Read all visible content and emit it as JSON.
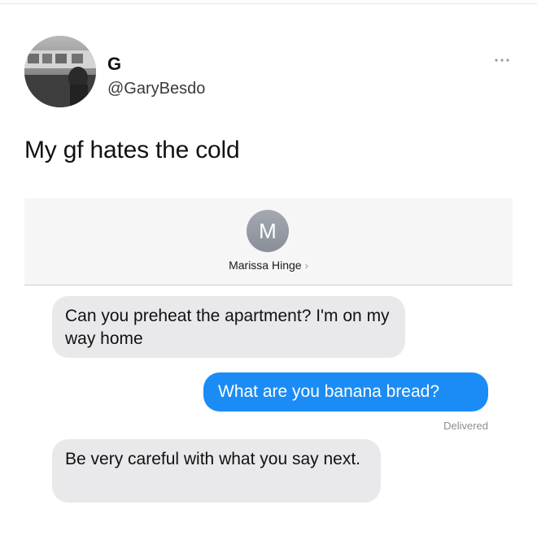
{
  "tweet": {
    "display_name": "G",
    "handle": "@GaryBesdo",
    "text": "My gf hates the cold",
    "avatar_icon": "profile-photo",
    "more_icon": "ellipsis-icon"
  },
  "conversation": {
    "contact_initial": "M",
    "contact_name": "Marissa Hinge",
    "contact_chevron": "›",
    "messages": [
      {
        "direction": "received",
        "text": "Can you preheat the apartment? I'm on my way home"
      },
      {
        "direction": "sent",
        "text": "What are you banana bread?"
      },
      {
        "direction": "received",
        "text": "Be very careful with what you say next."
      }
    ],
    "delivery_status": "Delivered"
  },
  "colors": {
    "sent_bubble": "#1b8cf5",
    "received_bubble": "#e9e9eb",
    "header_bg": "#f6f6f6"
  }
}
